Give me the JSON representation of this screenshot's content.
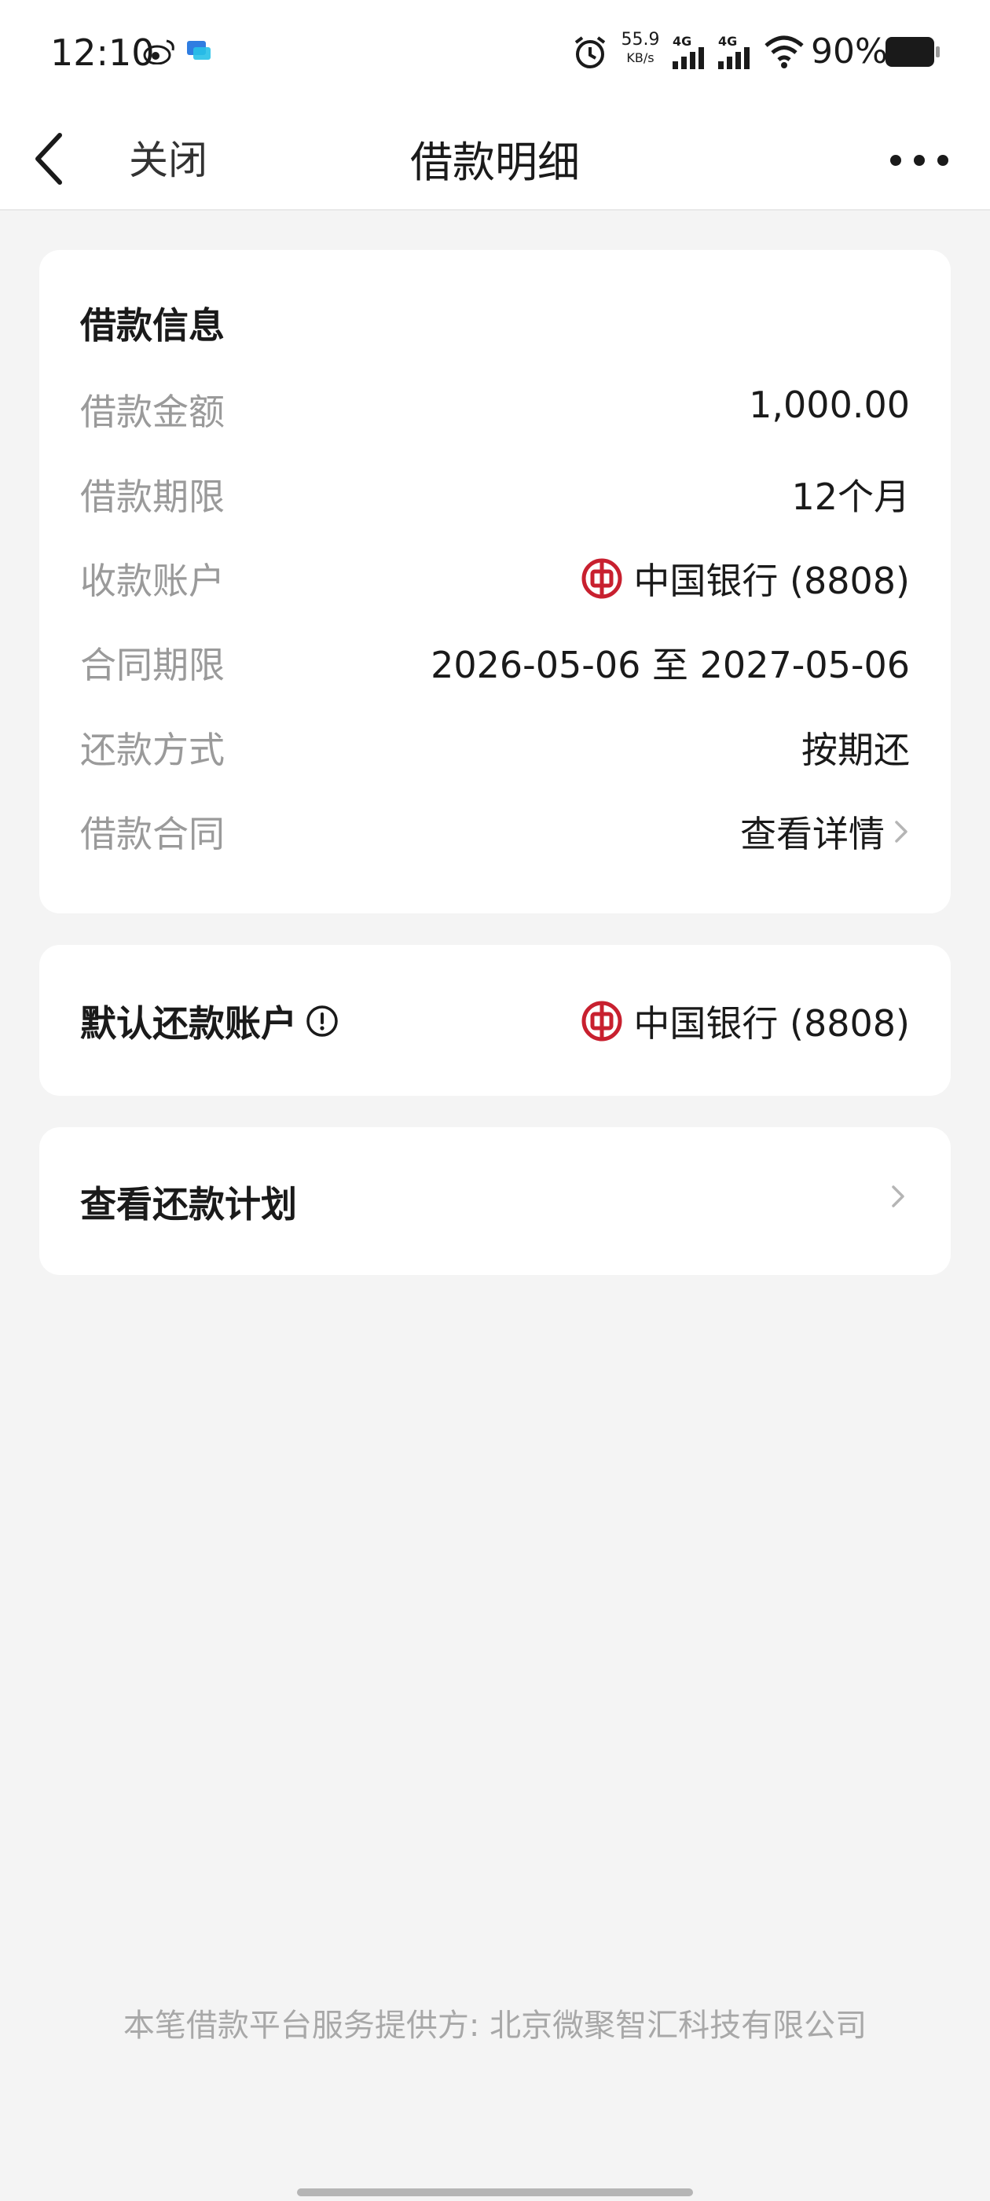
{
  "status_bar": {
    "time": "12:10",
    "net_speed_value": "55.9",
    "net_speed_unit": "KB/s",
    "signal_1_label": "4G",
    "signal_2_label": "4G",
    "battery_percent": "90%"
  },
  "nav": {
    "close_label": "关闭",
    "title": "借款明细"
  },
  "loan_info": {
    "title": "借款信息",
    "rows": [
      {
        "label": "借款金额",
        "value": "1,000.00"
      },
      {
        "label": "借款期限",
        "value": "12个月"
      },
      {
        "label": "收款账户",
        "value": "中国银行 (8808)"
      },
      {
        "label": "合同期限",
        "value": "2026-05-06 至 2027-05-06"
      },
      {
        "label": "还款方式",
        "value": "按期还"
      },
      {
        "label": "借款合同",
        "value": "查看详情"
      }
    ]
  },
  "repay_account": {
    "label": "默认还款账户",
    "value": "中国银行 (8808)"
  },
  "repay_plan": {
    "label": "查看还款计划"
  },
  "footer": {
    "text": "本笔借款平台服务提供方: 北京微聚智汇科技有限公司"
  },
  "colors": {
    "link": "#4d6a9e",
    "bank_red": "#c8202f",
    "label_gray": "#9a9a9a",
    "background": "#f4f4f4"
  },
  "icons": {
    "back": "chevron-left-icon",
    "more": "more-dots-icon",
    "bank": "bank-of-china-icon",
    "info": "info-circle-icon",
    "chevron": "chevron-right-icon"
  }
}
